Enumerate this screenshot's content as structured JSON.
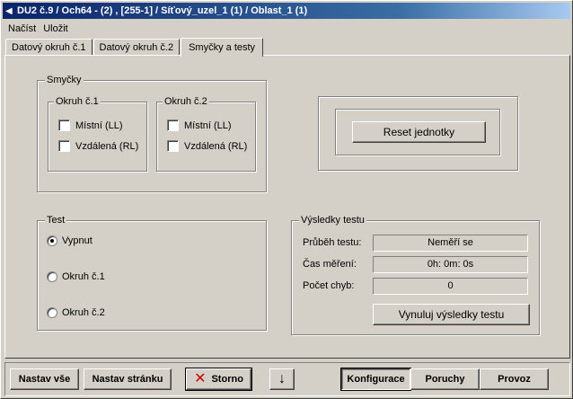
{
  "window": {
    "title": "DU2 č.9 / Och64 - (2) , [255-1] / Síťový_uzel_1 (1) / Oblast_1 (1)"
  },
  "menu": {
    "items": [
      {
        "label": "Načíst"
      },
      {
        "label": "Uložit"
      }
    ]
  },
  "tabs": [
    {
      "label": "Datový okruh č.1",
      "active": false
    },
    {
      "label": "Datový okruh č.2",
      "active": false
    },
    {
      "label": "Smyčky a testy",
      "active": true
    }
  ],
  "smycky": {
    "label": "Smyčky",
    "okruh1": {
      "label": "Okruh č.1",
      "mistni": {
        "label": "Místní (LL)",
        "checked": false
      },
      "vzdalena": {
        "label": "Vzdálená (RL)",
        "checked": false
      }
    },
    "okruh2": {
      "label": "Okruh č.2",
      "mistni": {
        "label": "Místní (LL)",
        "checked": false
      },
      "vzdalena": {
        "label": "Vzdálená (RL)",
        "checked": false
      }
    }
  },
  "reset": {
    "label": "Reset jednotky"
  },
  "test": {
    "label": "Test",
    "options": [
      {
        "label": "Vypnut",
        "selected": true
      },
      {
        "label": "Okruh č.1",
        "selected": false
      },
      {
        "label": "Okruh č.2",
        "selected": false
      }
    ]
  },
  "results": {
    "label": "Výsledky testu",
    "prubeh": {
      "label": "Průběh testu:",
      "value": "Neměří se"
    },
    "cas": {
      "label": "Čas měření:",
      "value": "0h: 0m: 0s"
    },
    "chyby": {
      "label": "Počet chyb:",
      "value": "0"
    },
    "reset_button": "Vynuluj výsledky testu"
  },
  "bottom": {
    "nastav_vse": "Nastav vše",
    "nastav_stranku": "Nastav stránku",
    "storno": "Storno",
    "konfigurace": "Konfigurace",
    "poruchy": "Poruchy",
    "provoz": "Provoz"
  },
  "icons": {
    "title": "arrow-left-icon",
    "storno": "x-icon",
    "down": "arrow-down-icon"
  },
  "colors": {
    "titlebar_start": "#0a246a",
    "titlebar_end": "#a6caf0",
    "face": "#d4d0c8",
    "storno_x": "#cc0000"
  }
}
